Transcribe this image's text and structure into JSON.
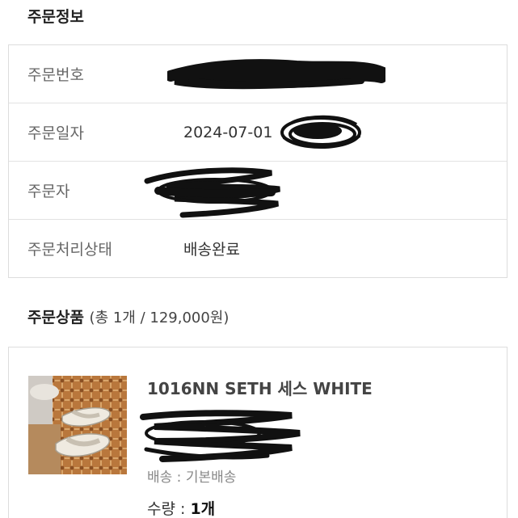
{
  "order_info": {
    "title": "주문정보",
    "rows": [
      {
        "label": "주문번호",
        "value": ""
      },
      {
        "label": "주문일자",
        "value": "2024-07-01"
      },
      {
        "label": "주문자",
        "value": ""
      },
      {
        "label": "주문처리상태",
        "value": "배송완료"
      }
    ]
  },
  "order_products": {
    "title": "주문상품",
    "summary": "(총 1개 / 129,000원)",
    "items": [
      {
        "name": "1016NN SETH 세스 WHITE",
        "shipping_label": "배송 : 기본배송",
        "quantity_label": "수량 :",
        "quantity_value": "1개",
        "thumbnail_icon": "product-thumbnail"
      }
    ]
  },
  "colors": {
    "border": "#dddddd",
    "label_text": "#666666",
    "redaction": "#111111"
  }
}
